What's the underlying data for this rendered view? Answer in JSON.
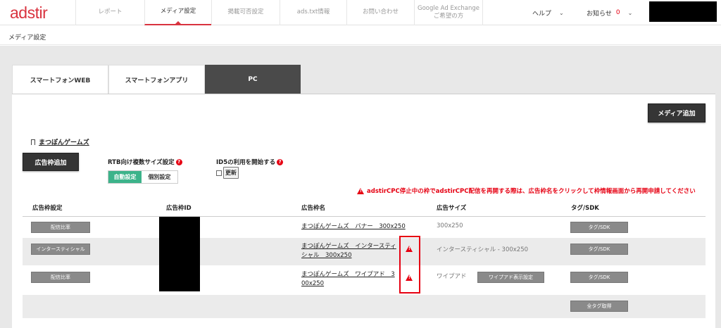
{
  "header": {
    "logo": "adstir",
    "nav": [
      {
        "label": "レポート"
      },
      {
        "label": "メディア設定"
      },
      {
        "label": "掲載可否設定"
      },
      {
        "label": "ads.txt情報"
      },
      {
        "label": "お問い合わせ"
      },
      {
        "label_line1": "Google Ad Exchange",
        "label_line2": "ご希望の方"
      }
    ],
    "help_label": "ヘルプ",
    "notice_label": "お知らせ",
    "notice_count": "0"
  },
  "breadcrumb": "メディア設定",
  "tabs": [
    {
      "label": "スマートフォンWEB"
    },
    {
      "label": "スマートフォンアプリ"
    },
    {
      "label": "PC"
    }
  ],
  "buttons": {
    "add_media": "メディア追加",
    "add_ad_slot": "広告枠追加",
    "update": "更新"
  },
  "media": {
    "name": "まつぽんゲームズ"
  },
  "settings": {
    "rtb_label": "RTB向け複数サイズ設定",
    "toggle_auto": "自動設定",
    "toggle_individual": "個別設定",
    "id5_label": "ID5の利用を開始する"
  },
  "warning_message": "adstirCPC停止中の枠でadstirCPC配信を再開する際は、広告枠名をクリックして枠情報画面から再開申請してください",
  "table": {
    "headers": [
      "広告枠設定",
      "広告枠ID",
      "広告枠名",
      "広告サイズ",
      "タグ/SDK"
    ],
    "rows": [
      {
        "setting_btn": "配信比率",
        "name_line1": "まつぽんゲームズ　バナー　300x250",
        "name_line2": "",
        "size": "300x250",
        "extra_btn": "",
        "tag_btn": "タグ/SDK"
      },
      {
        "setting_btn": "インタースティシャル",
        "name_line1": "まつぽんゲームズ　インタースティ",
        "name_line2": "シャル　300x250",
        "size": "インタースティシャル - 300x250",
        "extra_btn": "",
        "tag_btn": "タグ/SDK"
      },
      {
        "setting_btn": "配信比率",
        "name_line1": "まつぽんゲームズ　ワイプアド　3",
        "name_line2": "00x250",
        "size": "ワイプアド",
        "extra_btn": "ワイプアド表示設定",
        "tag_btn": "タグ/SDK"
      }
    ],
    "all_tags_btn": "全タグ取得"
  },
  "icons": [
    "chevron-down-icon",
    "bookmark-icon",
    "question-icon",
    "warning-icon"
  ],
  "colors": {
    "brand": "#d9333f",
    "alert": "#e60012",
    "toggle_on": "#3cb38a",
    "dark_button": "#353535"
  }
}
